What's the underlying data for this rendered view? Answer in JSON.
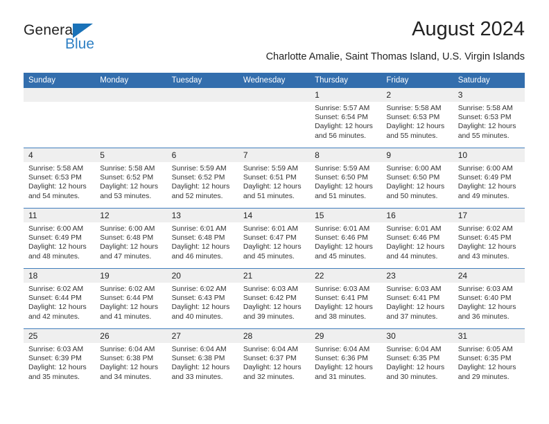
{
  "brand": {
    "name_part1": "General",
    "name_part2": "Blue",
    "triangle_color": "#1a72b8",
    "blue_color": "#2f80c4"
  },
  "header": {
    "title": "August 2024",
    "subtitle": "Charlotte Amalie, Saint Thomas Island, U.S. Virgin Islands"
  },
  "theme": {
    "header_bg": "#336ead",
    "header_text": "#ffffff",
    "daynum_bg": "#efefef",
    "week_divider": "#3f7cbb"
  },
  "calendar": {
    "weekday_headers": [
      "Sunday",
      "Monday",
      "Tuesday",
      "Wednesday",
      "Thursday",
      "Friday",
      "Saturday"
    ],
    "weeks": [
      [
        {
          "day": "",
          "lines": []
        },
        {
          "day": "",
          "lines": []
        },
        {
          "day": "",
          "lines": []
        },
        {
          "day": "",
          "lines": []
        },
        {
          "day": "1",
          "lines": [
            "Sunrise: 5:57 AM",
            "Sunset: 6:54 PM",
            "Daylight: 12 hours",
            "and 56 minutes."
          ]
        },
        {
          "day": "2",
          "lines": [
            "Sunrise: 5:58 AM",
            "Sunset: 6:53 PM",
            "Daylight: 12 hours",
            "and 55 minutes."
          ]
        },
        {
          "day": "3",
          "lines": [
            "Sunrise: 5:58 AM",
            "Sunset: 6:53 PM",
            "Daylight: 12 hours",
            "and 55 minutes."
          ]
        }
      ],
      [
        {
          "day": "4",
          "lines": [
            "Sunrise: 5:58 AM",
            "Sunset: 6:53 PM",
            "Daylight: 12 hours",
            "and 54 minutes."
          ]
        },
        {
          "day": "5",
          "lines": [
            "Sunrise: 5:58 AM",
            "Sunset: 6:52 PM",
            "Daylight: 12 hours",
            "and 53 minutes."
          ]
        },
        {
          "day": "6",
          "lines": [
            "Sunrise: 5:59 AM",
            "Sunset: 6:52 PM",
            "Daylight: 12 hours",
            "and 52 minutes."
          ]
        },
        {
          "day": "7",
          "lines": [
            "Sunrise: 5:59 AM",
            "Sunset: 6:51 PM",
            "Daylight: 12 hours",
            "and 51 minutes."
          ]
        },
        {
          "day": "8",
          "lines": [
            "Sunrise: 5:59 AM",
            "Sunset: 6:50 PM",
            "Daylight: 12 hours",
            "and 51 minutes."
          ]
        },
        {
          "day": "9",
          "lines": [
            "Sunrise: 6:00 AM",
            "Sunset: 6:50 PM",
            "Daylight: 12 hours",
            "and 50 minutes."
          ]
        },
        {
          "day": "10",
          "lines": [
            "Sunrise: 6:00 AM",
            "Sunset: 6:49 PM",
            "Daylight: 12 hours",
            "and 49 minutes."
          ]
        }
      ],
      [
        {
          "day": "11",
          "lines": [
            "Sunrise: 6:00 AM",
            "Sunset: 6:49 PM",
            "Daylight: 12 hours",
            "and 48 minutes."
          ]
        },
        {
          "day": "12",
          "lines": [
            "Sunrise: 6:00 AM",
            "Sunset: 6:48 PM",
            "Daylight: 12 hours",
            "and 47 minutes."
          ]
        },
        {
          "day": "13",
          "lines": [
            "Sunrise: 6:01 AM",
            "Sunset: 6:48 PM",
            "Daylight: 12 hours",
            "and 46 minutes."
          ]
        },
        {
          "day": "14",
          "lines": [
            "Sunrise: 6:01 AM",
            "Sunset: 6:47 PM",
            "Daylight: 12 hours",
            "and 45 minutes."
          ]
        },
        {
          "day": "15",
          "lines": [
            "Sunrise: 6:01 AM",
            "Sunset: 6:46 PM",
            "Daylight: 12 hours",
            "and 45 minutes."
          ]
        },
        {
          "day": "16",
          "lines": [
            "Sunrise: 6:01 AM",
            "Sunset: 6:46 PM",
            "Daylight: 12 hours",
            "and 44 minutes."
          ]
        },
        {
          "day": "17",
          "lines": [
            "Sunrise: 6:02 AM",
            "Sunset: 6:45 PM",
            "Daylight: 12 hours",
            "and 43 minutes."
          ]
        }
      ],
      [
        {
          "day": "18",
          "lines": [
            "Sunrise: 6:02 AM",
            "Sunset: 6:44 PM",
            "Daylight: 12 hours",
            "and 42 minutes."
          ]
        },
        {
          "day": "19",
          "lines": [
            "Sunrise: 6:02 AM",
            "Sunset: 6:44 PM",
            "Daylight: 12 hours",
            "and 41 minutes."
          ]
        },
        {
          "day": "20",
          "lines": [
            "Sunrise: 6:02 AM",
            "Sunset: 6:43 PM",
            "Daylight: 12 hours",
            "and 40 minutes."
          ]
        },
        {
          "day": "21",
          "lines": [
            "Sunrise: 6:03 AM",
            "Sunset: 6:42 PM",
            "Daylight: 12 hours",
            "and 39 minutes."
          ]
        },
        {
          "day": "22",
          "lines": [
            "Sunrise: 6:03 AM",
            "Sunset: 6:41 PM",
            "Daylight: 12 hours",
            "and 38 minutes."
          ]
        },
        {
          "day": "23",
          "lines": [
            "Sunrise: 6:03 AM",
            "Sunset: 6:41 PM",
            "Daylight: 12 hours",
            "and 37 minutes."
          ]
        },
        {
          "day": "24",
          "lines": [
            "Sunrise: 6:03 AM",
            "Sunset: 6:40 PM",
            "Daylight: 12 hours",
            "and 36 minutes."
          ]
        }
      ],
      [
        {
          "day": "25",
          "lines": [
            "Sunrise: 6:03 AM",
            "Sunset: 6:39 PM",
            "Daylight: 12 hours",
            "and 35 minutes."
          ]
        },
        {
          "day": "26",
          "lines": [
            "Sunrise: 6:04 AM",
            "Sunset: 6:38 PM",
            "Daylight: 12 hours",
            "and 34 minutes."
          ]
        },
        {
          "day": "27",
          "lines": [
            "Sunrise: 6:04 AM",
            "Sunset: 6:38 PM",
            "Daylight: 12 hours",
            "and 33 minutes."
          ]
        },
        {
          "day": "28",
          "lines": [
            "Sunrise: 6:04 AM",
            "Sunset: 6:37 PM",
            "Daylight: 12 hours",
            "and 32 minutes."
          ]
        },
        {
          "day": "29",
          "lines": [
            "Sunrise: 6:04 AM",
            "Sunset: 6:36 PM",
            "Daylight: 12 hours",
            "and 31 minutes."
          ]
        },
        {
          "day": "30",
          "lines": [
            "Sunrise: 6:04 AM",
            "Sunset: 6:35 PM",
            "Daylight: 12 hours",
            "and 30 minutes."
          ]
        },
        {
          "day": "31",
          "lines": [
            "Sunrise: 6:05 AM",
            "Sunset: 6:35 PM",
            "Daylight: 12 hours",
            "and 29 minutes."
          ]
        }
      ]
    ]
  }
}
